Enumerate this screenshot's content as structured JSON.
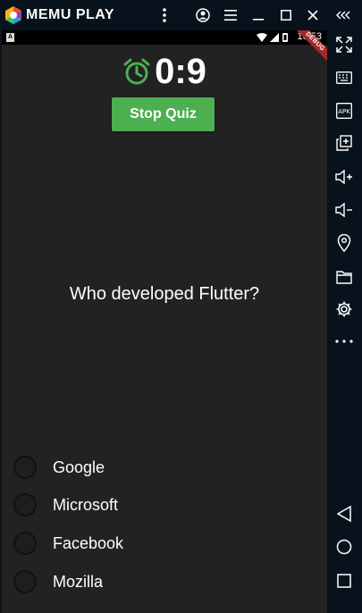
{
  "emulator": {
    "brand": "MEMU PLAY"
  },
  "statusbar": {
    "time": "10:53",
    "left_badge": "A",
    "ribbon": "DEBUG"
  },
  "quiz": {
    "timer": "0:9",
    "stop_label": "Stop Quiz",
    "question": "Who developed Flutter?",
    "options": [
      {
        "label": "Google",
        "selected": false
      },
      {
        "label": "Microsoft",
        "selected": false
      },
      {
        "label": "Facebook",
        "selected": false
      },
      {
        "label": "Mozilla",
        "selected": false
      }
    ]
  },
  "colors": {
    "accent_green": "#4caf50",
    "screen_bg": "#222222",
    "emulator_bg": "#08121c"
  },
  "icons": {
    "titlebar": [
      "memu-logo-icon",
      "more-vert-icon",
      "account-icon",
      "menu-icon",
      "minimize-icon",
      "maximize-icon",
      "close-icon",
      "collapse-sidebar-icon"
    ],
    "sidebar": [
      "fullscreen-icon",
      "keyboard-icon",
      "apk-icon",
      "multi-window-icon",
      "volume-up-icon",
      "volume-down-icon",
      "location-icon",
      "folder-icon",
      "settings-icon",
      "more-horiz-icon",
      "back-icon",
      "home-icon",
      "recents-icon"
    ]
  }
}
